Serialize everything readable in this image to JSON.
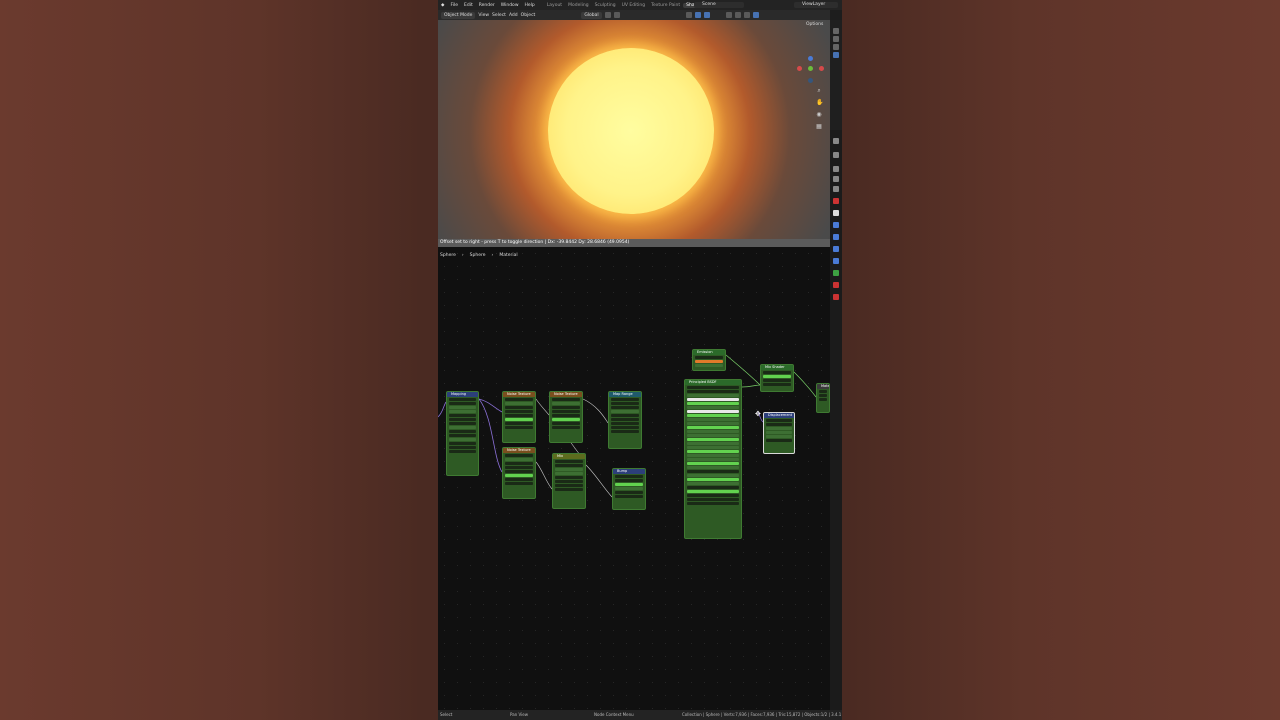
{
  "menu": {
    "items": [
      "File",
      "Edit",
      "Render",
      "Window",
      "Help"
    ],
    "workspaces": [
      "Layout",
      "Modeling",
      "Sculpting",
      "UV Editing",
      "Texture Paint",
      "Shading",
      "A"
    ],
    "active_workspace": "Shading",
    "scene": "Scene",
    "view_layer": "ViewLayer"
  },
  "viewport_header": {
    "mode": "Object Mode",
    "menus": [
      "View",
      "Select",
      "Add",
      "Object"
    ],
    "orientation": "Global",
    "options": "Options"
  },
  "modal_status": "Offset set to right - press T to toggle direction | Dx: -39.8442   Dy: 28.6846 (49.0954)",
  "breadcrumb": [
    "Sphere",
    "Sphere",
    "Material"
  ],
  "nodes": [
    {
      "title": "Mapping",
      "color": "blue"
    },
    {
      "title": "Noise Texture",
      "color": "brown"
    },
    {
      "title": "Noise Texture",
      "color": "brown"
    },
    {
      "title": "Map Range",
      "color": "teal"
    },
    {
      "title": "Noise Texture",
      "color": "brown"
    },
    {
      "title": "Mix",
      "color": "olive"
    },
    {
      "title": "Bump",
      "color": "blue"
    },
    {
      "title": "Emission",
      "color": "green"
    },
    {
      "title": "Principled BSDF",
      "color": "green"
    },
    {
      "title": "Mix Shader",
      "color": "green"
    },
    {
      "title": "Displacement",
      "color": "blue"
    },
    {
      "title": "Material Output",
      "color": "out"
    }
  ],
  "statusbar": {
    "select": "Select",
    "pan": "Pan View",
    "context": "Node Context Menu",
    "stats": "Collection | Sphere | Verts:7,936 | Faces:7,936 | Tris:15,872 | Objects:1/2 | 3.4.1"
  },
  "colors": {
    "accent": "#4772b3",
    "sun_core": "#fff389",
    "node_body": "#2e5a24",
    "node_slider": "#62d24f"
  }
}
